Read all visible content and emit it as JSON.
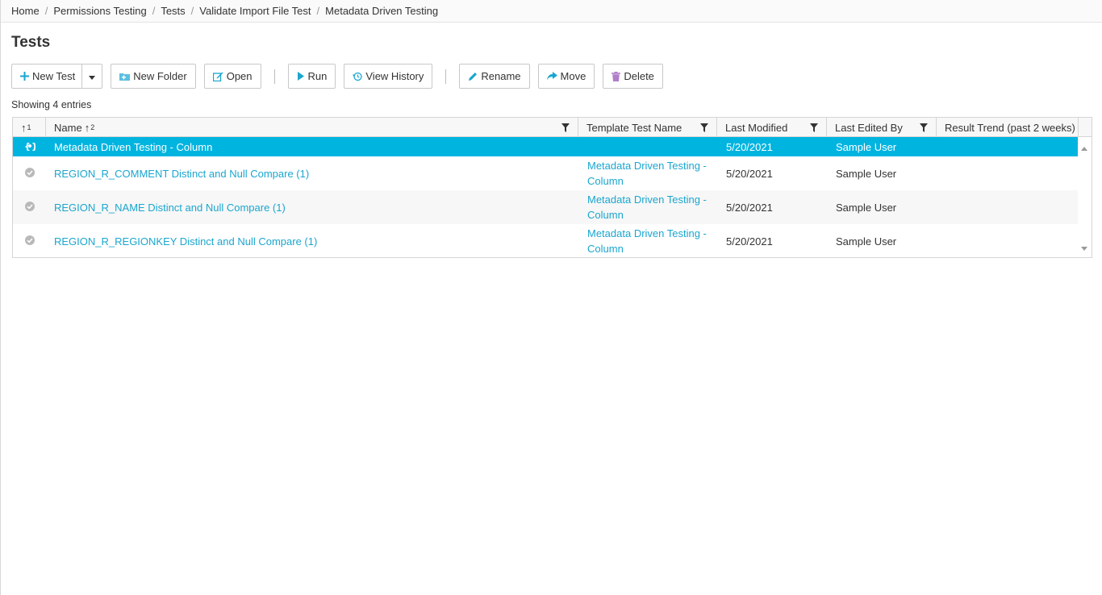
{
  "breadcrumb": [
    "Home",
    "Permissions Testing",
    "Tests",
    "Validate Import File Test",
    "Metadata Driven Testing"
  ],
  "page_title": "Tests",
  "toolbar": {
    "new_test": "New Test",
    "new_folder": "New Folder",
    "open": "Open",
    "run": "Run",
    "view_history": "View History",
    "rename": "Rename",
    "move": "Move",
    "delete": "Delete"
  },
  "showing": "Showing 4 entries",
  "table": {
    "headers": {
      "icon_col": "1",
      "name": "Name",
      "name_sort": "2",
      "template": "Template Test Name",
      "last_modified": "Last Modified",
      "last_edited_by": "Last Edited By",
      "result_trend": "Result Trend (past 2 weeks)"
    },
    "rows": [
      {
        "name": "Metadata Driven Testing - Column",
        "template": "",
        "last_modified": "5/20/2021",
        "last_edited_by": "Sample User",
        "icon": "metadata-template-icon",
        "selected": true
      },
      {
        "name": "REGION_R_COMMENT Distinct and Null Compare (1)",
        "template": "Metadata Driven Testing - Column",
        "last_modified": "5/20/2021",
        "last_edited_by": "Sample User",
        "icon": "check-circle-icon"
      },
      {
        "name": "REGION_R_NAME Distinct and Null Compare (1)",
        "template": "Metadata Driven Testing - Column",
        "last_modified": "5/20/2021",
        "last_edited_by": "Sample User",
        "icon": "check-circle-icon"
      },
      {
        "name": "REGION_R_REGIONKEY Distinct and Null Compare (1)",
        "template": "Metadata Driven Testing - Column",
        "last_modified": "5/20/2021",
        "last_edited_by": "Sample User",
        "icon": "check-circle-icon"
      }
    ]
  },
  "colors": {
    "accent": "#00b4e0",
    "link": "#1aa6cf"
  }
}
